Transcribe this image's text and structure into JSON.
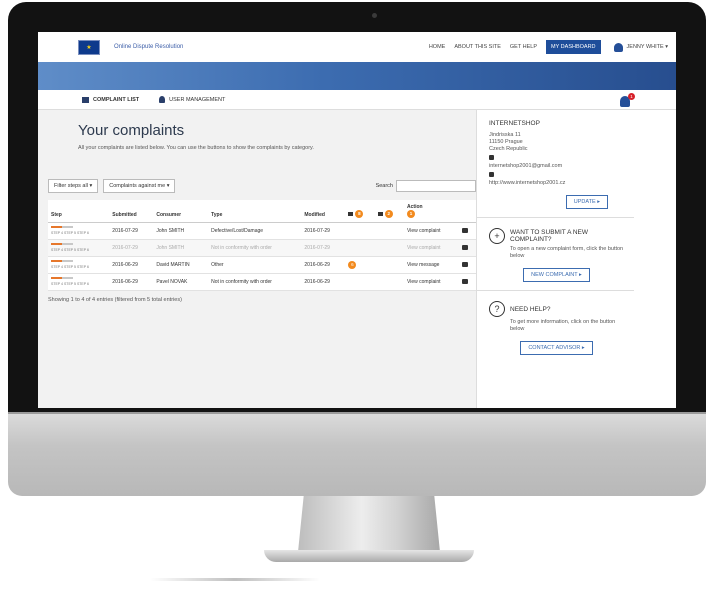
{
  "header": {
    "site_name": "Online Dispute Resolution",
    "nav": [
      "HOME",
      "ABOUT THIS SITE",
      "GET HELP",
      "MY DASHBOARD"
    ],
    "user_name": "Jenny WHITE ▾"
  },
  "subnav": {
    "tabs": [
      "COMPLAINT LIST",
      "USER MANAGEMENT"
    ],
    "notification_count": "1"
  },
  "main": {
    "title": "Your complaints",
    "description": "All your complaints are listed below. You can use the buttons to show the complaints by category.",
    "filter_steps": "Filter steps all ▾",
    "filter_complaints": "Complaints against me ▾",
    "search_label": "Search",
    "columns": [
      "Step",
      "Submitted",
      "Consumer",
      "Type",
      "Modified",
      "",
      "",
      "Action",
      ""
    ],
    "rows": [
      {
        "step": "STEP 4 STEP 5 STEP 6",
        "submitted": "2016-07-29",
        "consumer": "John SMITH",
        "type": "Defective/Lost/Damage",
        "modified": "2016-07-29",
        "badge": "",
        "action": "View complaint"
      },
      {
        "step": "STEP 4 STEP 5 STEP 6",
        "submitted": "2016-07-29",
        "consumer": "John SMITH",
        "type": "Not in conformity with order",
        "modified": "2016-07-29",
        "badge": "",
        "action": "View complaint"
      },
      {
        "step": "STEP 4 STEP 5 STEP 6",
        "submitted": "2016-06-29",
        "consumer": "David MARTIN",
        "type": "Other",
        "modified": "2016-06-29",
        "badge": "6",
        "action": "View message"
      },
      {
        "step": "STEP 4 STEP 5 STEP 6",
        "submitted": "2016-06-29",
        "consumer": "Pavel NOVAK",
        "type": "Not in conformity with order",
        "modified": "2016-06-29",
        "badge": "",
        "action": "View complaint"
      }
    ],
    "header_badges": [
      "8",
      "2",
      "1"
    ],
    "footer": "Showing 1 to 4 of 4 entries (filtered from 5 total entries)"
  },
  "sidebar": {
    "shop_name": "INTERNETSHOP",
    "address": [
      "Jindrisska 11",
      "11150 Prague",
      "Czech Republic"
    ],
    "email": "internetshop2001@gmail.com",
    "website": "http://www.internetshop2001.cz",
    "update_btn": "UPDATE ▸",
    "submit_title": "WANT TO SUBMIT A NEW COMPLAINT?",
    "submit_text": "To open a new complaint form, click the button below",
    "submit_btn": "NEW COMPLAINT ▸",
    "help_title": "NEED HELP?",
    "help_text": "To get more information, click on the button below",
    "help_btn": "CONTACT ADVISOR ▸"
  }
}
